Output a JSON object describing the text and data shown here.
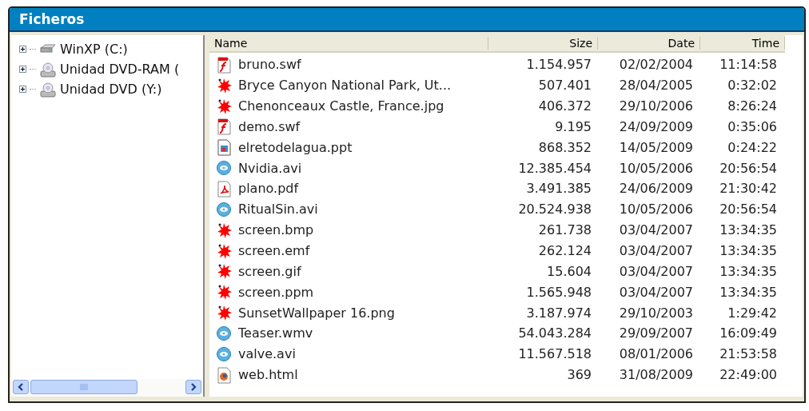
{
  "window": {
    "title": "Ficheros"
  },
  "tree": {
    "items": [
      {
        "label": "WinXP (C:)",
        "kind": "disk",
        "expanded": false
      },
      {
        "label": "Unidad DVD-RAM (",
        "kind": "dvd",
        "expanded": false
      },
      {
        "label": "Unidad DVD (Y:)",
        "kind": "dvd",
        "expanded": false
      }
    ]
  },
  "table": {
    "columns": [
      "Name",
      "Size",
      "Date",
      "Time"
    ],
    "rows": [
      {
        "kind": "flash",
        "name": "bruno.swf",
        "size": "1.154.957",
        "date": "02/02/2004",
        "time": "11:14:58"
      },
      {
        "kind": "image",
        "name": "Bryce Canyon National Park, Ut...",
        "size": "507.401",
        "date": "28/04/2005",
        "time": "0:32:02"
      },
      {
        "kind": "image",
        "name": "Chenonceaux Castle, France.jpg",
        "size": "406.372",
        "date": "29/10/2006",
        "time": "8:26:24"
      },
      {
        "kind": "flash",
        "name": "demo.swf",
        "size": "9.195",
        "date": "24/09/2009",
        "time": "0:35:06"
      },
      {
        "kind": "ppt",
        "name": "elretodelagua.ppt",
        "size": "868.352",
        "date": "14/05/2009",
        "time": "0:24:22"
      },
      {
        "kind": "video",
        "name": "Nvidia.avi",
        "size": "12.385.454",
        "date": "10/05/2006",
        "time": "20:56:54"
      },
      {
        "kind": "pdf",
        "name": "plano.pdf",
        "size": "3.491.385",
        "date": "24/06/2009",
        "time": "21:30:42"
      },
      {
        "kind": "video",
        "name": "RitualSin.avi",
        "size": "20.524.938",
        "date": "10/05/2006",
        "time": "20:56:54"
      },
      {
        "kind": "image",
        "name": "screen.bmp",
        "size": "261.738",
        "date": "03/04/2007",
        "time": "13:34:35"
      },
      {
        "kind": "image",
        "name": "screen.emf",
        "size": "262.124",
        "date": "03/04/2007",
        "time": "13:34:35"
      },
      {
        "kind": "image",
        "name": "screen.gif",
        "size": "15.604",
        "date": "03/04/2007",
        "time": "13:34:35"
      },
      {
        "kind": "image",
        "name": "screen.ppm",
        "size": "1.565.948",
        "date": "03/04/2007",
        "time": "13:34:35"
      },
      {
        "kind": "image",
        "name": "SunsetWallpaper 16.png",
        "size": "3.187.974",
        "date": "29/10/2003",
        "time": "1:29:42"
      },
      {
        "kind": "video",
        "name": "Teaser.wmv",
        "size": "54.043.284",
        "date": "29/09/2007",
        "time": "16:09:49"
      },
      {
        "kind": "video",
        "name": "valve.avi",
        "size": "11.567.518",
        "date": "08/01/2006",
        "time": "21:53:58"
      },
      {
        "kind": "html",
        "name": "web.html",
        "size": "369",
        "date": "31/08/2009",
        "time": "22:49:00"
      }
    ]
  }
}
